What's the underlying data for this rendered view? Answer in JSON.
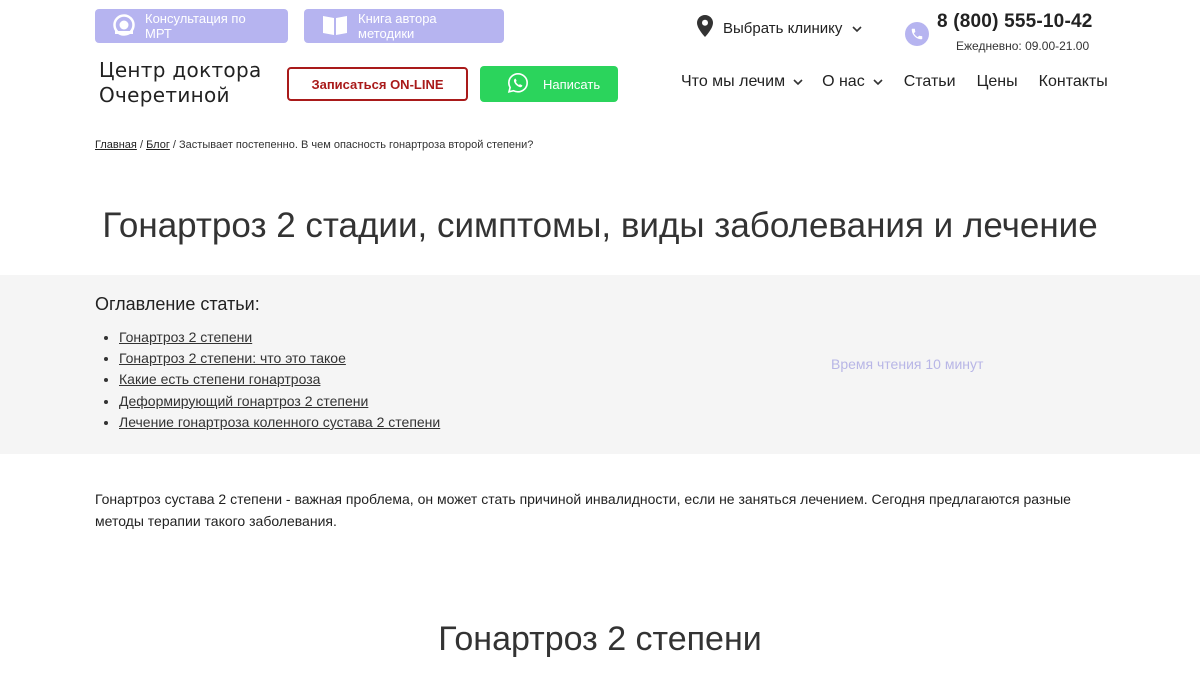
{
  "header": {
    "top_buttons": {
      "mri_label": "Консультация по МРТ",
      "book_label": "Книга автора методики"
    },
    "clinic_select_label": "Выбрать клинику",
    "phone": "8 (800) 555-10-42",
    "hours": "Ежедневно: 09.00-21.00",
    "logo_line1": "Центр доктора",
    "logo_line2": "Очеретиной",
    "online_button": "Записаться ON-LINE",
    "write_button": "Написать",
    "nav": {
      "treat": "Что мы лечим",
      "about": "О нас",
      "articles": "Статьи",
      "prices": "Цены",
      "contacts": "Контакты"
    }
  },
  "breadcrumb": {
    "home": "Главная",
    "blog": "Блог",
    "current": "Застывает постепенно. В чем опасность гонартроза второй степени?"
  },
  "page_title": "Гонартроз 2 стадии, симптомы, виды заболевания и лечение",
  "toc": {
    "title": "Оглавление статьи:",
    "items": [
      "Гонартроз 2 степени",
      "Гонартроз 2 степени: что это такое",
      "Какие есть степени гонартроза",
      "Деформирующий гонартроз 2 степени",
      "Лечение гонартроза коленного сустава 2 степени"
    ],
    "read_time": "Время чтения 10 минут"
  },
  "intro_text": "Гонартроз сустава 2 степени - важная проблема, он может стать причиной инвалидности, если не заняться лечением. Сегодня предлагаются разные методы терапии такого заболевания.",
  "section_heading": "Гонартроз 2 степени",
  "icons": {
    "mri": "mri-machine-icon",
    "book": "book-icon",
    "location": "location-pin-icon",
    "phone": "phone-icon",
    "whatsapp": "whatsapp-icon",
    "chevron": "chevron-down-icon"
  },
  "colors": {
    "lavender": "#b6b4f0",
    "red_accent": "#a91a1a",
    "whatsapp_green": "#2bd45c",
    "toc_background": "#f5f5f5",
    "read_time_text": "#b8b6e6"
  }
}
